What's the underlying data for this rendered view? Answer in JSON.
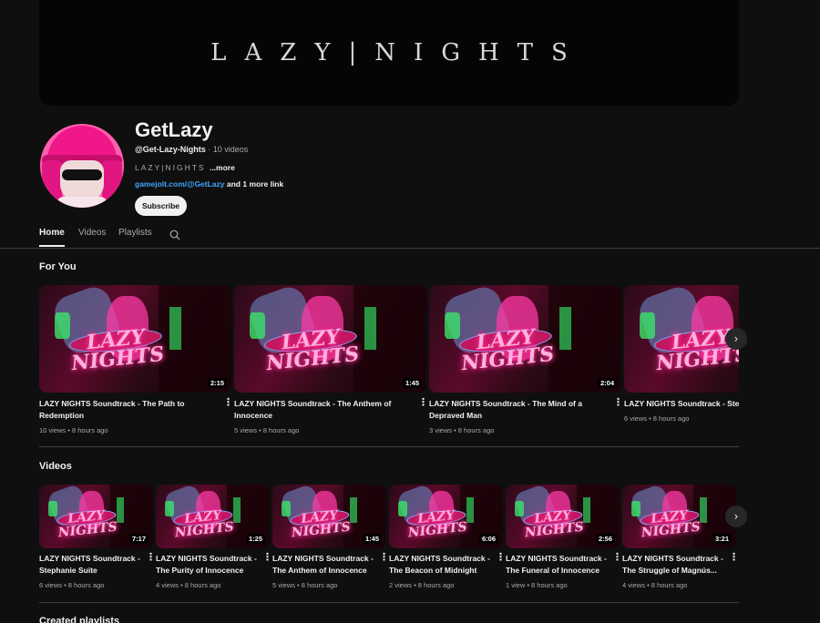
{
  "banner": {
    "text": "LAZY|NIGHTS"
  },
  "channel": {
    "name": "GetLazy",
    "handle": "@Get-Lazy-Nights",
    "video_count": " · 10 videos",
    "description": "LAZY|NIGHTS",
    "more_label": "...more",
    "link_url": "gamejolt.com/@GetLazy",
    "link_extra": " and 1 more link",
    "subscribe_label": "Subscribe"
  },
  "tabs": [
    {
      "label": "Home",
      "active": true
    },
    {
      "label": "Videos",
      "active": false
    },
    {
      "label": "Playlists",
      "active": false
    }
  ],
  "icons": {
    "search": "search-icon",
    "next": "chevron-right-icon",
    "more": "more-vert-icon"
  },
  "for_you": {
    "title": "For You",
    "videos": [
      {
        "title": "LAZY NIGHTS Soundtrack - The Path to Redemption",
        "duration": "2:15",
        "meta": "10 views • 8 hours ago"
      },
      {
        "title": "LAZY NIGHTS Soundtrack - The Anthem of Innocence",
        "duration": "1:45",
        "meta": "5 views • 8 hours ago"
      },
      {
        "title": "LAZY NIGHTS Soundtrack - The Mind of a Depraved Man",
        "duration": "2:04",
        "meta": "3 views • 8 hours ago"
      },
      {
        "title": "LAZY NIGHTS Soundtrack - Steph",
        "duration": "",
        "meta": "6 views • 8 hours ago"
      }
    ]
  },
  "videos_section": {
    "title": "Videos",
    "videos": [
      {
        "title": "LAZY NIGHTS Soundtrack - Stephanie Suite",
        "duration": "7:17",
        "meta": "6 views • 8 hours ago"
      },
      {
        "title": "LAZY NIGHTS Soundtrack - The Purity of Innocence",
        "duration": "1:25",
        "meta": "4 views • 8 hours ago"
      },
      {
        "title": "LAZY NIGHTS Soundtrack - The Anthem of Innocence",
        "duration": "1:45",
        "meta": "5 views • 8 hours ago"
      },
      {
        "title": "LAZY NIGHTS Soundtrack - The Beacon of Midnight",
        "duration": "6:06",
        "meta": "2 views • 8 hours ago"
      },
      {
        "title": "LAZY NIGHTS Soundtrack - The Funeral of Innocence",
        "duration": "2:56",
        "meta": "1 view • 8 hours ago"
      },
      {
        "title": "LAZY NIGHTS Soundtrack - The Struggle of Magnús...",
        "duration": "3:21",
        "meta": "4 views • 8 hours ago"
      }
    ]
  },
  "playlists_section": {
    "title": "Created playlists"
  },
  "thumbnail_text": {
    "line1": "LAZY",
    "line2": "NIGHTS"
  }
}
